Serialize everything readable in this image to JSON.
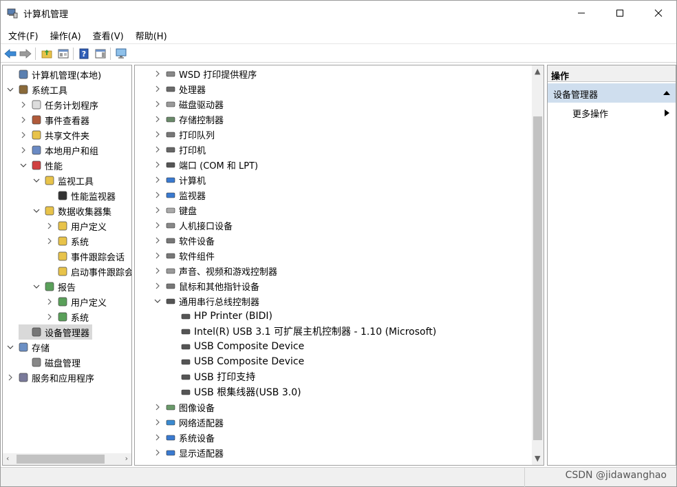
{
  "window": {
    "title": "计算机管理"
  },
  "menubar": {
    "items": [
      "文件(F)",
      "操作(A)",
      "查看(V)",
      "帮助(H)"
    ]
  },
  "left_tree": {
    "items": [
      {
        "label": "计算机管理(本地)",
        "icon": "computer-management-icon"
      },
      {
        "label": "系统工具",
        "icon": "system-tools-icon"
      },
      {
        "label": "任务计划程序",
        "icon": "task-scheduler-icon"
      },
      {
        "label": "事件查看器",
        "icon": "event-viewer-icon"
      },
      {
        "label": "共享文件夹",
        "icon": "shared-folders-icon"
      },
      {
        "label": "本地用户和组",
        "icon": "users-groups-icon"
      },
      {
        "label": "性能",
        "icon": "performance-icon"
      },
      {
        "label": "监视工具",
        "icon": "folder-icon"
      },
      {
        "label": "性能监视器",
        "icon": "perf-monitor-icon"
      },
      {
        "label": "数据收集器集",
        "icon": "folder-icon"
      },
      {
        "label": "用户定义",
        "icon": "collector-icon"
      },
      {
        "label": "系统",
        "icon": "collector-icon"
      },
      {
        "label": "事件跟踪会话",
        "icon": "collector-icon"
      },
      {
        "label": "启动事件跟踪会",
        "icon": "collector-icon"
      },
      {
        "label": "报告",
        "icon": "report-folder-icon"
      },
      {
        "label": "用户定义",
        "icon": "report-icon"
      },
      {
        "label": "系统",
        "icon": "report-icon"
      },
      {
        "label": "设备管理器",
        "icon": "device-manager-icon"
      },
      {
        "label": "存储",
        "icon": "storage-icon"
      },
      {
        "label": "磁盘管理",
        "icon": "disk-management-icon"
      },
      {
        "label": "服务和应用程序",
        "icon": "services-icon"
      }
    ]
  },
  "device_tree": {
    "items": [
      {
        "label": "WSD 打印提供程序"
      },
      {
        "label": "处理器"
      },
      {
        "label": "磁盘驱动器"
      },
      {
        "label": "存储控制器"
      },
      {
        "label": "打印队列"
      },
      {
        "label": "打印机"
      },
      {
        "label": "端口 (COM 和 LPT)"
      },
      {
        "label": "计算机"
      },
      {
        "label": "监视器"
      },
      {
        "label": "键盘"
      },
      {
        "label": "人机接口设备"
      },
      {
        "label": "软件设备"
      },
      {
        "label": "软件组件"
      },
      {
        "label": "声音、视频和游戏控制器"
      },
      {
        "label": "鼠标和其他指针设备"
      },
      {
        "label": "通用串行总线控制器"
      },
      {
        "label": "HP Printer (BIDI)"
      },
      {
        "label": "Intel(R) USB 3.1 可扩展主机控制器 - 1.10 (Microsoft)"
      },
      {
        "label": "USB Composite Device"
      },
      {
        "label": "USB Composite Device"
      },
      {
        "label": "USB 打印支持"
      },
      {
        "label": "USB 根集线器(USB 3.0)"
      },
      {
        "label": "图像设备"
      },
      {
        "label": "网络适配器"
      },
      {
        "label": "系统设备"
      },
      {
        "label": "显示适配器"
      }
    ]
  },
  "actions": {
    "header": "操作",
    "section": "设备管理器",
    "more": "更多操作"
  },
  "watermark": "CSDN @jidawanghao"
}
